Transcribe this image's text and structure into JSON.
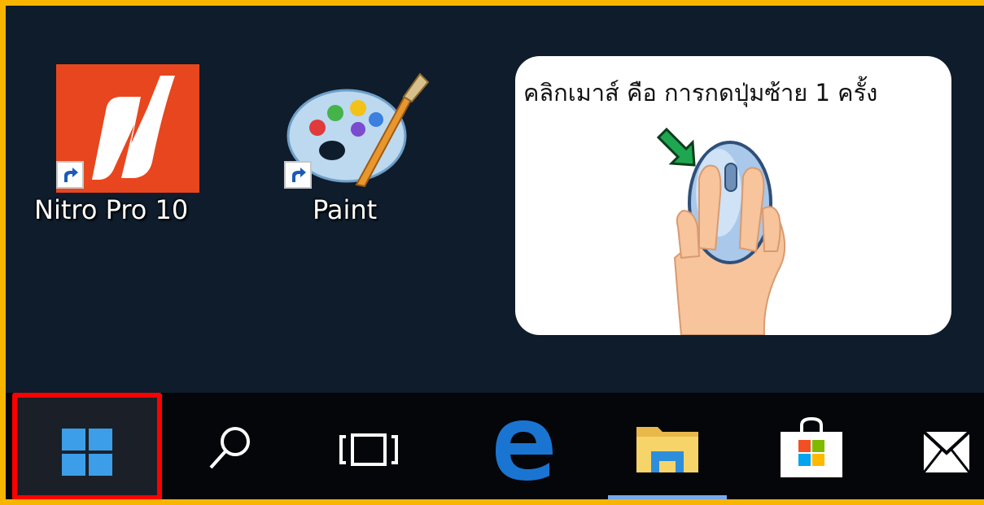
{
  "desktop": {
    "icons": [
      {
        "label": "Nitro Pro 10",
        "icon": "nitro-pro-icon"
      },
      {
        "label": "Paint",
        "icon": "paint-palette-icon"
      }
    ]
  },
  "callout": {
    "text": "คลิกเมาส์ คือ การกดปุ่มซ้าย 1 ครั้ง",
    "illustration": "hand-clicking-mouse-illustration"
  },
  "taskbar": {
    "items": [
      {
        "name": "start",
        "icon": "windows-start-icon",
        "highlighted": true
      },
      {
        "name": "search",
        "icon": "search-icon"
      },
      {
        "name": "task-view",
        "icon": "task-view-icon"
      },
      {
        "name": "edge",
        "icon": "edge-browser-icon"
      },
      {
        "name": "file-explorer",
        "icon": "file-explorer-icon",
        "active": true
      },
      {
        "name": "store",
        "icon": "store-icon"
      },
      {
        "name": "mail",
        "icon": "mail-icon"
      }
    ]
  },
  "colors": {
    "frame_border": "#f7b500",
    "highlight": "#ff0000",
    "desktop_bg": "#0e1c2b",
    "taskbar_bg": "#05060a",
    "active_indicator": "#78a9ea"
  }
}
